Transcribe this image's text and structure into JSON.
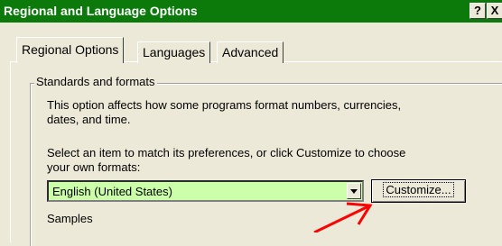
{
  "window": {
    "title": "Regional and Language Options",
    "help_label": "?",
    "close_label": "X"
  },
  "tabs": [
    {
      "label": "Regional Options",
      "active": true
    },
    {
      "label": "Languages",
      "active": false
    },
    {
      "label": "Advanced",
      "active": false
    }
  ],
  "standards": {
    "group_label": "Standards and formats",
    "desc_line1": "This option affects how some programs format numbers, currencies,",
    "desc_line2": "dates, and time.",
    "select_line1": "Select an item to match its preferences, or click Customize to choose",
    "select_line2": "your own formats:",
    "selected_value": "English (United States)",
    "customize_label": "Customize..."
  },
  "samples": {
    "label": "Samples"
  },
  "colors": {
    "titlebar": "#0b7a0b",
    "combo_background": "#ccffaa",
    "annotation_arrow": "#ff0000"
  }
}
